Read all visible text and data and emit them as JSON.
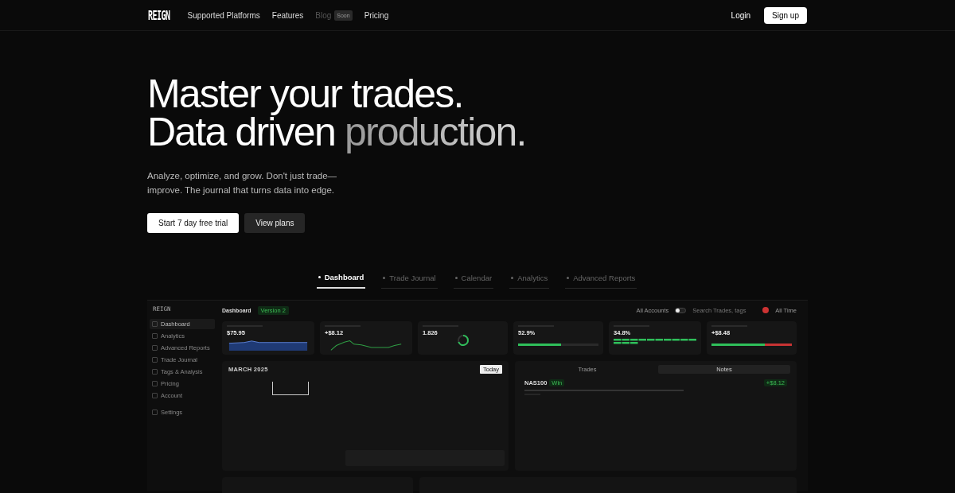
{
  "nav": {
    "logo": "REIGN",
    "links": [
      {
        "label": "Supported Platforms",
        "disabled": false
      },
      {
        "label": "Features",
        "disabled": false
      },
      {
        "label": "Blog",
        "disabled": true,
        "badge": "Soon"
      },
      {
        "label": "Pricing",
        "disabled": false
      }
    ],
    "login": "Login",
    "signup": "Sign up"
  },
  "hero": {
    "title_line_1": "Master your trades.",
    "title_line_2": "Data driven",
    "title_accent": "production.",
    "subtitle": "Analyze, optimize, and grow. Don't just trade—improve. The journal that turns data into edge.",
    "primary_button": "Start 7 day free trial",
    "secondary_button": "View plans"
  },
  "tabs": [
    {
      "label": "Dashboard",
      "selected": true
    },
    {
      "label": "Trade Journal",
      "selected": false
    },
    {
      "label": "Calendar",
      "selected": false
    },
    {
      "label": "Analytics",
      "selected": false
    },
    {
      "label": "Advanced Reports",
      "selected": false
    }
  ],
  "preview": {
    "logo": "REIGN",
    "title": "Dashboard",
    "version_badge": "Version 2",
    "account_filter": "All Accounts",
    "search_placeholder": "Search Trades, tags",
    "period": "All Time",
    "sidebar": [
      {
        "label": "Dashboard",
        "selected": true
      },
      {
        "label": "Analytics",
        "selected": false
      },
      {
        "label": "Advanced Reports",
        "selected": false
      },
      {
        "label": "Trade Journal",
        "selected": false
      },
      {
        "label": "Tags & Analysis",
        "selected": false
      },
      {
        "label": "Pricing",
        "selected": false
      },
      {
        "label": "Account",
        "selected": false
      },
      {
        "label": "Settings",
        "selected": false
      }
    ],
    "stats": [
      {
        "kind": "area",
        "value": "$75.95"
      },
      {
        "kind": "line",
        "value": "+$8.12"
      },
      {
        "kind": "ring",
        "value": "1.826"
      },
      {
        "kind": "bar",
        "value": "52.9%",
        "level": 0.53
      },
      {
        "kind": "segments",
        "value": "34.8%"
      },
      {
        "kind": "split",
        "value": "+$8.48",
        "level": 0.66
      }
    ],
    "calendar": {
      "month": "MARCH 2025",
      "view_button": "Today"
    },
    "notes_panel": {
      "tabs": [
        {
          "label": "Trades",
          "selected": false
        },
        {
          "label": "Notes",
          "selected": true
        }
      ],
      "notes": [
        {
          "symbol": "NAS100",
          "result": "Win",
          "pnl": "+$8.12"
        }
      ]
    }
  }
}
